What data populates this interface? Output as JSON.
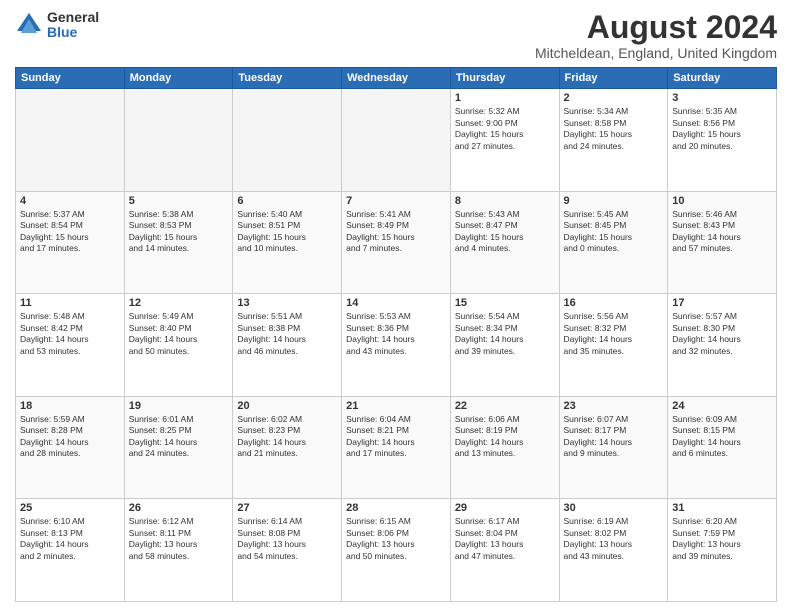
{
  "logo": {
    "general": "General",
    "blue": "Blue"
  },
  "title": "August 2024",
  "location": "Mitcheldean, England, United Kingdom",
  "days_of_week": [
    "Sunday",
    "Monday",
    "Tuesday",
    "Wednesday",
    "Thursday",
    "Friday",
    "Saturday"
  ],
  "weeks": [
    [
      {
        "day": "",
        "info": ""
      },
      {
        "day": "",
        "info": ""
      },
      {
        "day": "",
        "info": ""
      },
      {
        "day": "",
        "info": ""
      },
      {
        "day": "1",
        "info": "Sunrise: 5:32 AM\nSunset: 9:00 PM\nDaylight: 15 hours\nand 27 minutes."
      },
      {
        "day": "2",
        "info": "Sunrise: 5:34 AM\nSunset: 8:58 PM\nDaylight: 15 hours\nand 24 minutes."
      },
      {
        "day": "3",
        "info": "Sunrise: 5:35 AM\nSunset: 8:56 PM\nDaylight: 15 hours\nand 20 minutes."
      }
    ],
    [
      {
        "day": "4",
        "info": "Sunrise: 5:37 AM\nSunset: 8:54 PM\nDaylight: 15 hours\nand 17 minutes."
      },
      {
        "day": "5",
        "info": "Sunrise: 5:38 AM\nSunset: 8:53 PM\nDaylight: 15 hours\nand 14 minutes."
      },
      {
        "day": "6",
        "info": "Sunrise: 5:40 AM\nSunset: 8:51 PM\nDaylight: 15 hours\nand 10 minutes."
      },
      {
        "day": "7",
        "info": "Sunrise: 5:41 AM\nSunset: 8:49 PM\nDaylight: 15 hours\nand 7 minutes."
      },
      {
        "day": "8",
        "info": "Sunrise: 5:43 AM\nSunset: 8:47 PM\nDaylight: 15 hours\nand 4 minutes."
      },
      {
        "day": "9",
        "info": "Sunrise: 5:45 AM\nSunset: 8:45 PM\nDaylight: 15 hours\nand 0 minutes."
      },
      {
        "day": "10",
        "info": "Sunrise: 5:46 AM\nSunset: 8:43 PM\nDaylight: 14 hours\nand 57 minutes."
      }
    ],
    [
      {
        "day": "11",
        "info": "Sunrise: 5:48 AM\nSunset: 8:42 PM\nDaylight: 14 hours\nand 53 minutes."
      },
      {
        "day": "12",
        "info": "Sunrise: 5:49 AM\nSunset: 8:40 PM\nDaylight: 14 hours\nand 50 minutes."
      },
      {
        "day": "13",
        "info": "Sunrise: 5:51 AM\nSunset: 8:38 PM\nDaylight: 14 hours\nand 46 minutes."
      },
      {
        "day": "14",
        "info": "Sunrise: 5:53 AM\nSunset: 8:36 PM\nDaylight: 14 hours\nand 43 minutes."
      },
      {
        "day": "15",
        "info": "Sunrise: 5:54 AM\nSunset: 8:34 PM\nDaylight: 14 hours\nand 39 minutes."
      },
      {
        "day": "16",
        "info": "Sunrise: 5:56 AM\nSunset: 8:32 PM\nDaylight: 14 hours\nand 35 minutes."
      },
      {
        "day": "17",
        "info": "Sunrise: 5:57 AM\nSunset: 8:30 PM\nDaylight: 14 hours\nand 32 minutes."
      }
    ],
    [
      {
        "day": "18",
        "info": "Sunrise: 5:59 AM\nSunset: 8:28 PM\nDaylight: 14 hours\nand 28 minutes."
      },
      {
        "day": "19",
        "info": "Sunrise: 6:01 AM\nSunset: 8:25 PM\nDaylight: 14 hours\nand 24 minutes."
      },
      {
        "day": "20",
        "info": "Sunrise: 6:02 AM\nSunset: 8:23 PM\nDaylight: 14 hours\nand 21 minutes."
      },
      {
        "day": "21",
        "info": "Sunrise: 6:04 AM\nSunset: 8:21 PM\nDaylight: 14 hours\nand 17 minutes."
      },
      {
        "day": "22",
        "info": "Sunrise: 6:06 AM\nSunset: 8:19 PM\nDaylight: 14 hours\nand 13 minutes."
      },
      {
        "day": "23",
        "info": "Sunrise: 6:07 AM\nSunset: 8:17 PM\nDaylight: 14 hours\nand 9 minutes."
      },
      {
        "day": "24",
        "info": "Sunrise: 6:09 AM\nSunset: 8:15 PM\nDaylight: 14 hours\nand 6 minutes."
      }
    ],
    [
      {
        "day": "25",
        "info": "Sunrise: 6:10 AM\nSunset: 8:13 PM\nDaylight: 14 hours\nand 2 minutes."
      },
      {
        "day": "26",
        "info": "Sunrise: 6:12 AM\nSunset: 8:11 PM\nDaylight: 13 hours\nand 58 minutes."
      },
      {
        "day": "27",
        "info": "Sunrise: 6:14 AM\nSunset: 8:08 PM\nDaylight: 13 hours\nand 54 minutes."
      },
      {
        "day": "28",
        "info": "Sunrise: 6:15 AM\nSunset: 8:06 PM\nDaylight: 13 hours\nand 50 minutes."
      },
      {
        "day": "29",
        "info": "Sunrise: 6:17 AM\nSunset: 8:04 PM\nDaylight: 13 hours\nand 47 minutes."
      },
      {
        "day": "30",
        "info": "Sunrise: 6:19 AM\nSunset: 8:02 PM\nDaylight: 13 hours\nand 43 minutes."
      },
      {
        "day": "31",
        "info": "Sunrise: 6:20 AM\nSunset: 7:59 PM\nDaylight: 13 hours\nand 39 minutes."
      }
    ]
  ]
}
